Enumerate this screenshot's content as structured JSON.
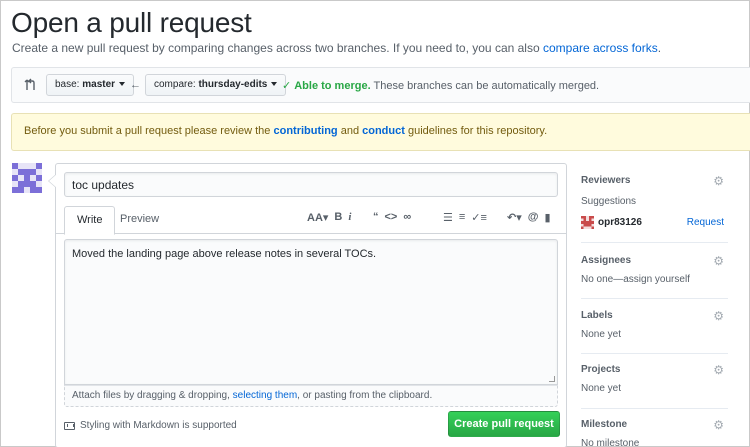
{
  "page": {
    "title": "Open a pull request",
    "subtitle": "Create a new pull request by comparing changes across two branches. If you need to, you can also",
    "subtitle_link": "compare across forks",
    "subtitle_end": "."
  },
  "range": {
    "base_prefix": "base:",
    "base_branch": "master",
    "compare_prefix": "compare:",
    "compare_branch": "thursday-edits",
    "merge_status": "Able to merge.",
    "merge_note": "These branches can be automatically merged."
  },
  "flash": {
    "pre": "Before you submit a pull request please review the",
    "link1": "contributing",
    "mid": "and",
    "link2": "conduct",
    "post": "guidelines for this repository."
  },
  "form": {
    "title_value": "toc updates",
    "tabs": [
      "Write",
      "Preview"
    ],
    "body_value": "Moved the landing page above release notes in several TOCs.",
    "attach_pre": "Attach files by dragging & dropping,",
    "attach_link": "selecting them",
    "attach_post": ", or pasting from the clipboard.",
    "markdown_note": "Styling with Markdown is supported",
    "submit_label": "Create pull request"
  },
  "sidebar": {
    "reviewers": {
      "heading": "Reviewers",
      "suggestions_label": "Suggestions",
      "suggested_user": "opr83126",
      "request_label": "Request"
    },
    "assignees": {
      "heading": "Assignees",
      "value": "No one—assign yourself"
    },
    "labels": {
      "heading": "Labels",
      "value": "None yet"
    },
    "projects": {
      "heading": "Projects",
      "value": "None yet"
    },
    "milestone": {
      "heading": "Milestone",
      "value": "No milestone"
    }
  },
  "colors": {
    "success": "#28a745",
    "link": "#0366d6",
    "flash_bg": "#fffbdd",
    "avatar": "#7c6fd8"
  }
}
